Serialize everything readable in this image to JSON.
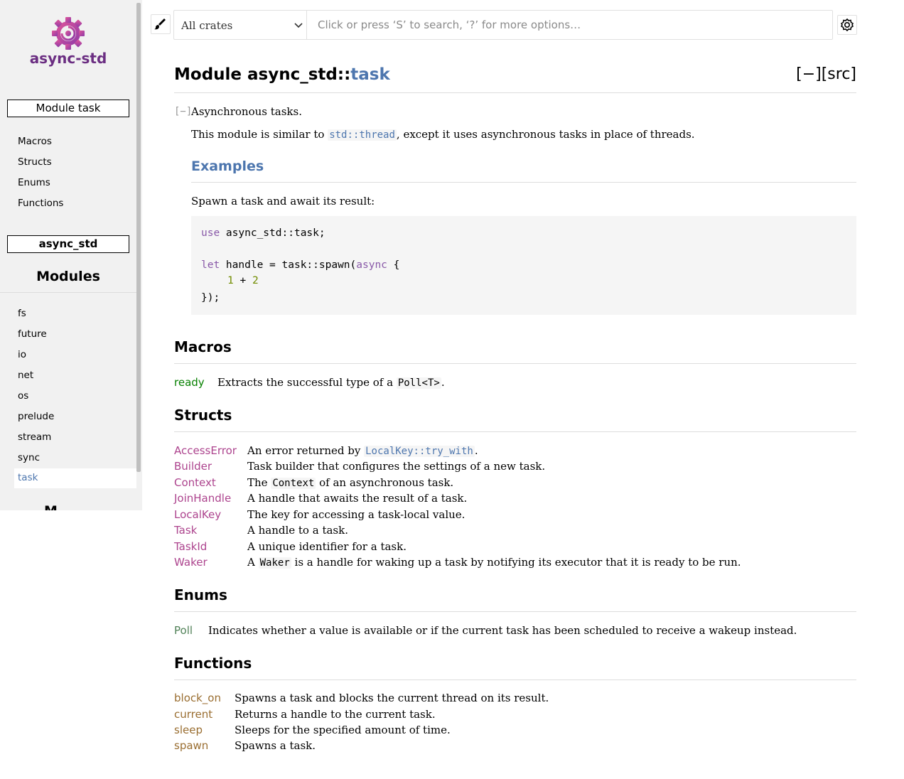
{
  "sidebar": {
    "crate_name": "async-std",
    "location_box": "Module task",
    "section_links": [
      "Macros",
      "Structs",
      "Enums",
      "Functions"
    ],
    "crate_box": "async_std",
    "modules_heading": "Modules",
    "modules": [
      "fs",
      "future",
      "io",
      "net",
      "os",
      "prelude",
      "stream",
      "sync"
    ],
    "current_module": "task",
    "cut_heading": "M"
  },
  "topbar": {
    "crate_filter": "All crates",
    "search_placeholder": "Click or press ‘S’ to search, ‘?’ for more options…",
    "theme_icon": "paintbrush-icon",
    "settings_icon": "gear-icon"
  },
  "page": {
    "title_prefix": "Module async_std::",
    "title_item": "task",
    "out_of_band": "[−][src]",
    "toggle": "[−]",
    "summary": "Asynchronous tasks.",
    "desc_before": "This module is similar to ",
    "desc_code": "std::thread",
    "desc_after": ", except it uses asynchronous tasks in place of threads.",
    "examples_heading": "Examples",
    "examples_intro": "Spawn a task and await its result:",
    "code": {
      "l1_kw": "use",
      "l1_rest": " async_std::task;",
      "l2_kw": "let",
      "l2_mid": " handle = task::spawn(",
      "l2_kw2": "async",
      "l2_end": " {",
      "l3_a": "1",
      "l3_op": " + ",
      "l3_b": "2",
      "l4": "});"
    }
  },
  "sections": {
    "macros": {
      "heading": "Macros",
      "items": [
        {
          "name": "ready",
          "desc_a": "Extracts the successful type of a ",
          "code": "Poll<T>",
          "desc_b": "."
        }
      ]
    },
    "structs": {
      "heading": "Structs",
      "items": [
        {
          "name": "AccessError",
          "desc_a": "An error returned by ",
          "code": "LocalKey::try_with",
          "desc_b": "."
        },
        {
          "name": "Builder",
          "desc_a": "Task builder that configures the settings of a new task."
        },
        {
          "name": "Context",
          "desc_a": "The ",
          "code": "Context",
          "desc_b": " of an asynchronous task."
        },
        {
          "name": "JoinHandle",
          "desc_a": "A handle that awaits the result of a task."
        },
        {
          "name": "LocalKey",
          "desc_a": "The key for accessing a task-local value."
        },
        {
          "name": "Task",
          "desc_a": "A handle to a task."
        },
        {
          "name": "TaskId",
          "desc_a": "A unique identifier for a task."
        },
        {
          "name": "Waker",
          "desc_a": "A ",
          "code": "Waker",
          "desc_b": " is a handle for waking up a task by notifying its executor that it is ready to be run."
        }
      ]
    },
    "enums": {
      "heading": "Enums",
      "items": [
        {
          "name": "Poll",
          "desc_a": "Indicates whether a value is available or if the current task has been scheduled to receive a wakeup instead."
        }
      ]
    },
    "functions": {
      "heading": "Functions",
      "items": [
        {
          "name": "block_on",
          "desc_a": "Spawns a task and blocks the current thread on its result."
        },
        {
          "name": "current",
          "desc_a": "Returns a handle to the current task."
        },
        {
          "name": "sleep",
          "desc_a": "Sleeps for the specified amount of time."
        },
        {
          "name": "spawn",
          "desc_a": "Spawns a task."
        }
      ]
    }
  },
  "colors": {
    "link_blue": "#4d76ae",
    "macro": "#068000",
    "struct": "#ad448e",
    "enum": "#508157",
    "function": "#9a6e31",
    "brand": "#6b2e82"
  }
}
